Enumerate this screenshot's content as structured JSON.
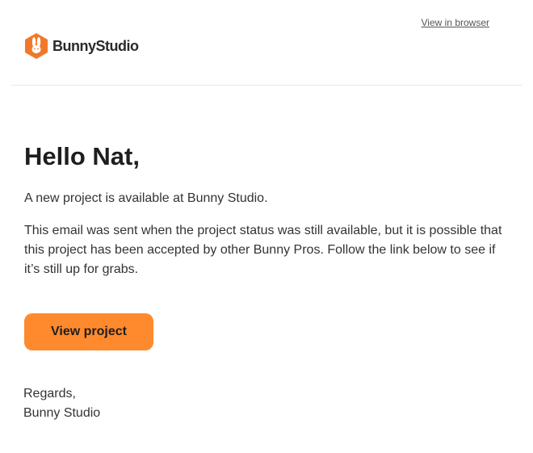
{
  "header": {
    "view_in_browser": "View in browser",
    "brand_name": "BunnyStudio",
    "logo_icon": "bunny-hexagon-icon",
    "brand_color": "#F0782A"
  },
  "main": {
    "greeting": "Hello Nat,",
    "intro": "A new project is available at Bunny Studio.",
    "notice": "This email was sent when the project status was still available, but it is possible that this project has been accepted by other Bunny Pros. Follow the link below to see if it’s still up for grabs.",
    "cta_label": "View project",
    "cta_color": "#FF8A2E"
  },
  "footer": {
    "regards": "Regards,",
    "signature": "Bunny Studio"
  }
}
